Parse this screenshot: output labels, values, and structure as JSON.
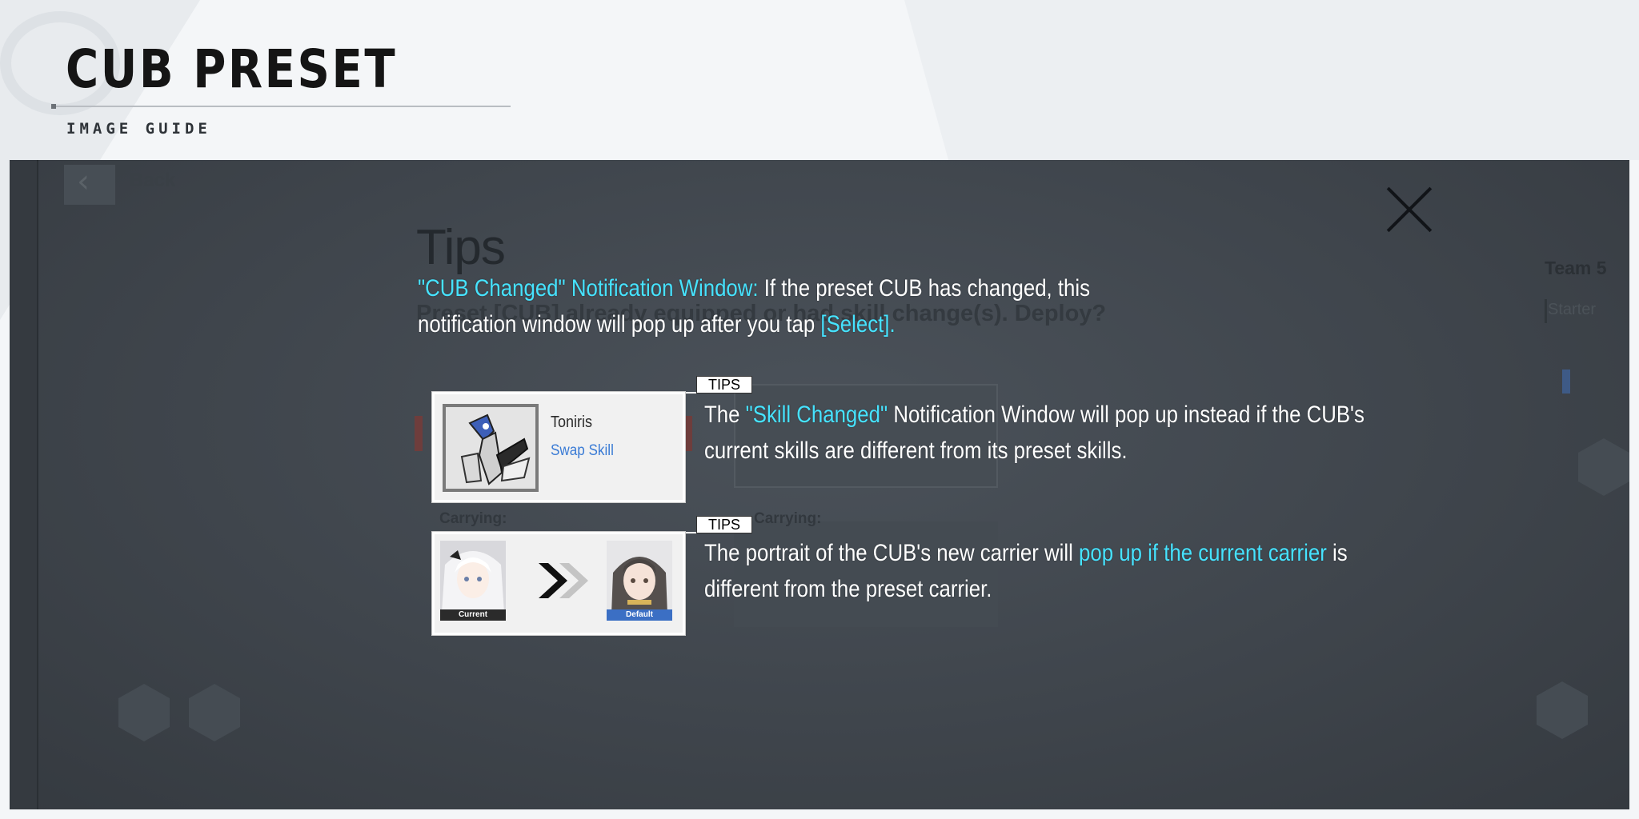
{
  "header": {
    "title": "CUB PRESET",
    "subtitle": "IMAGE GUIDE"
  },
  "screen": {
    "back_label": "Back",
    "team_label": "Team 5",
    "starter_label": "Starter",
    "prompt": "Preset [CUB] already equipped or had skill change(s). Deploy?",
    "carrying_label": "Carrying:"
  },
  "tips": {
    "heading": "Tips",
    "intro": {
      "highlight": "\"CUB Changed\" Notification Window:",
      "text1": " If the preset CUB has changed, this notification window will pop up after you tap ",
      "highlight2": "[Select]."
    },
    "tag_label": "TIPS",
    "tip1": {
      "prefix": "The ",
      "highlight": "\"Skill Changed\"",
      "suffix": " Notification Window will pop up instead if the CUB's current skills are different from its preset skills.",
      "card": {
        "cub_name": "Toniris",
        "swap_skill": "Swap Skill"
      }
    },
    "tip2": {
      "prefix": "The portrait of the CUB's new carrier will ",
      "highlight": "pop up if the current carrier",
      "suffix": " is different from the preset carrier.",
      "card": {
        "current_label": "Current",
        "default_label": "Default"
      }
    }
  },
  "colors": {
    "highlight": "#46e3ff",
    "swap_skill": "#3a7bd5",
    "default_tag": "#3b6fc4"
  },
  "icons": {
    "close": "close-icon",
    "swap_arrow": "double-chevron-right-icon"
  }
}
